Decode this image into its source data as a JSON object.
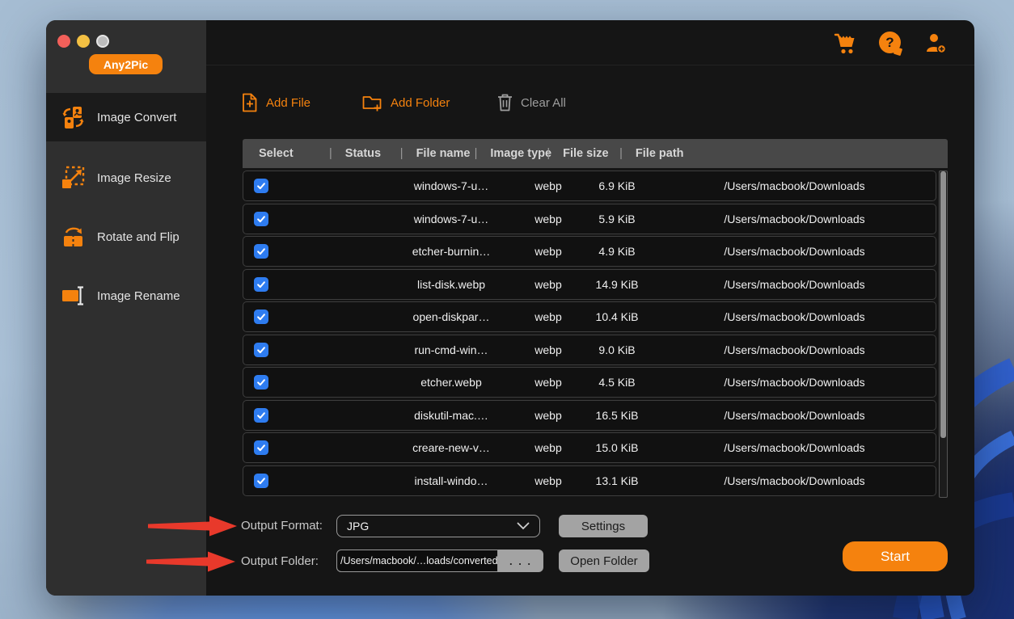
{
  "window": {
    "badge": "Any2Pic"
  },
  "colors": {
    "accent": "#f5820e",
    "checkbox_blue": "#2e7cf0",
    "arrow_red": "#e8392b",
    "header_gray": "#484848"
  },
  "icons": {
    "traffic": [
      "close-button",
      "minimize-button",
      "zoom-button"
    ],
    "titlebar": [
      "cart-icon",
      "help-icon",
      "add-user-icon"
    ],
    "help_glyph": "?"
  },
  "sidebar": {
    "items": [
      {
        "label": "Image Convert",
        "icon": "image-convert-icon",
        "active": true
      },
      {
        "label": "Image Resize",
        "icon": "image-resize-icon",
        "active": false
      },
      {
        "label": "Rotate and Flip",
        "icon": "rotate-flip-icon",
        "active": false
      },
      {
        "label": "Image Rename",
        "icon": "image-rename-icon",
        "active": false
      }
    ]
  },
  "toolbar": {
    "add_file": "Add File",
    "add_folder": "Add Folder",
    "clear_all": "Clear All"
  },
  "table": {
    "headers": [
      "Select",
      "Status",
      "File name",
      "Image type",
      "File size",
      "File path"
    ],
    "header_separator": "|",
    "rows": [
      {
        "checked": true,
        "name": "windows-7-u…",
        "type": "webp",
        "size": "6.9 KiB",
        "path": "/Users/macbook/Downloads"
      },
      {
        "checked": true,
        "name": "windows-7-u…",
        "type": "webp",
        "size": "5.9 KiB",
        "path": "/Users/macbook/Downloads"
      },
      {
        "checked": true,
        "name": "etcher-burnin…",
        "type": "webp",
        "size": "4.9 KiB",
        "path": "/Users/macbook/Downloads"
      },
      {
        "checked": true,
        "name": "list-disk.webp",
        "type": "webp",
        "size": "14.9 KiB",
        "path": "/Users/macbook/Downloads"
      },
      {
        "checked": true,
        "name": "open-diskpar…",
        "type": "webp",
        "size": "10.4 KiB",
        "path": "/Users/macbook/Downloads"
      },
      {
        "checked": true,
        "name": "run-cmd-win…",
        "type": "webp",
        "size": "9.0 KiB",
        "path": "/Users/macbook/Downloads"
      },
      {
        "checked": true,
        "name": "etcher.webp",
        "type": "webp",
        "size": "4.5 KiB",
        "path": "/Users/macbook/Downloads"
      },
      {
        "checked": true,
        "name": "diskutil-mac.…",
        "type": "webp",
        "size": "16.5 KiB",
        "path": "/Users/macbook/Downloads"
      },
      {
        "checked": true,
        "name": "creare-new-v…",
        "type": "webp",
        "size": "15.0 KiB",
        "path": "/Users/macbook/Downloads"
      },
      {
        "checked": true,
        "name": "install-windo…",
        "type": "webp",
        "size": "13.1 KiB",
        "path": "/Users/macbook/Downloads"
      }
    ]
  },
  "footer": {
    "output_format_label": "Output Format:",
    "format_value": "JPG",
    "settings_label": "Settings",
    "output_folder_label": "Output Folder:",
    "folder_value": "/Users/macbook/…loads/converted",
    "ellipsis_label": ". . .",
    "open_folder_label": "Open Folder",
    "start_label": "Start"
  }
}
